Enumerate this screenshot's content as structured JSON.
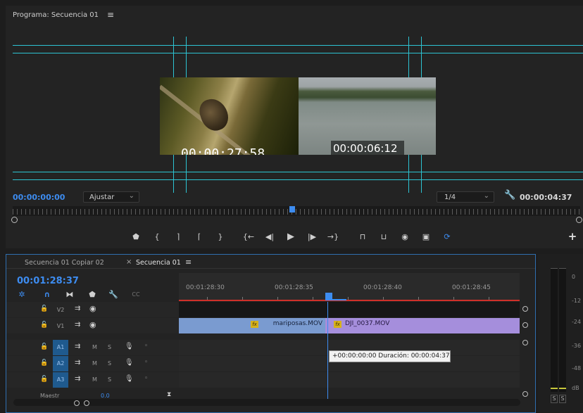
{
  "program_monitor": {
    "title": "Programa: Secuencia 01",
    "menu_icon": "hamburger-menu-icon",
    "overlay_left_timecode": "00:00:27:58",
    "overlay_right_timecode": "00:00:06:12",
    "current_time": "00:00:00:00",
    "zoom_value": "Ajustar",
    "resolution_value": "1/4",
    "duration": "00:00:04:37",
    "settings_icon": "wrench-icon",
    "transport": [
      {
        "name": "add-marker",
        "glyph": "⬟"
      },
      {
        "name": "mark-in",
        "glyph": "{"
      },
      {
        "name": "mark-out",
        "glyph": "}"
      },
      {
        "name": "go-to-in",
        "glyph": "{←"
      },
      {
        "name": "step-back",
        "glyph": "◀|"
      },
      {
        "name": "play",
        "glyph": "▶"
      },
      {
        "name": "step-forward",
        "glyph": "|▶"
      },
      {
        "name": "go-to-out",
        "glyph": "→}"
      },
      {
        "name": "lift",
        "glyph": "⬚"
      },
      {
        "name": "extract",
        "glyph": "⬚"
      },
      {
        "name": "export-frame",
        "glyph": "◉"
      },
      {
        "name": "comparison-view",
        "glyph": "▣"
      },
      {
        "name": "proxy-toggle",
        "glyph": "⟳"
      }
    ],
    "add_button": "+"
  },
  "timeline": {
    "tabs": [
      {
        "label": "Secuencia 01 Copiar 02",
        "active": false
      },
      {
        "label": "Secuencia 01",
        "active": true
      }
    ],
    "tab_close": "×",
    "tab_menu": "≡",
    "current_time": "00:01:28:37",
    "ruler_labels": [
      "00:01:28:30",
      "00:01:28:35",
      "00:01:28:40",
      "00:01:28:45"
    ],
    "tracks": [
      {
        "id": "V2",
        "type": "video",
        "selected": false
      },
      {
        "id": "V1",
        "type": "video",
        "selected": false
      },
      {
        "id": "A1",
        "type": "audio",
        "selected": true
      },
      {
        "id": "A2",
        "type": "audio",
        "selected": true
      },
      {
        "id": "A3",
        "type": "audio",
        "selected": true
      }
    ],
    "audio_buttons": {
      "mute": "M",
      "solo": "S"
    },
    "clips": {
      "mariposas": {
        "name": "mariposas.MOV",
        "fx": "fx"
      },
      "dji": {
        "name": "DJI_0037.MOV",
        "fx": "fx"
      }
    },
    "tooltip": "+00:00:00:00 Duración: 00:00:04:37",
    "partial_track": "Maestr",
    "partial_value": "0.0"
  },
  "audio_meter": {
    "scale": [
      "0",
      "-12",
      "-24",
      "-36",
      "-48",
      "dB"
    ],
    "solo_left": "S",
    "solo_right": "S"
  }
}
